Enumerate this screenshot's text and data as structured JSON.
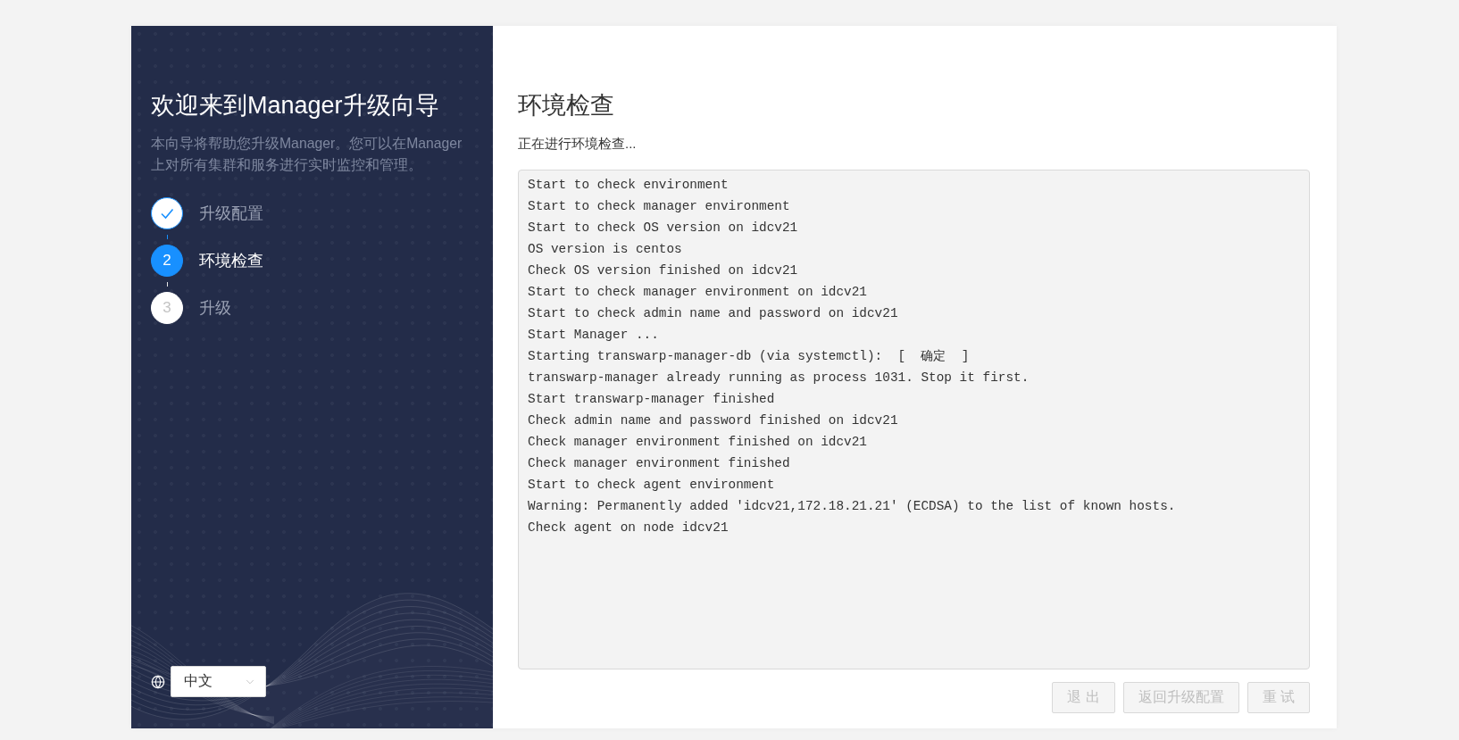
{
  "sidebar": {
    "title": "欢迎来到Manager升级向导",
    "description": "本向导将帮助您升级Manager。您可以在Manager上对所有集群和服务进行实时监控和管理。",
    "steps": [
      {
        "label": "升级配置",
        "completed": true,
        "selected": false
      },
      {
        "label": "环境检查",
        "completed": false,
        "selected": true,
        "number": "2"
      },
      {
        "label": "升级",
        "completed": false,
        "selected": false,
        "number": "3"
      }
    ],
    "language": {
      "value": "中文"
    }
  },
  "main": {
    "title": "环境检查",
    "subtitle": "正在进行环境检查...",
    "log_lines": [
      "Start to check environment",
      "Start to check manager environment",
      "Start to check OS version on idcv21",
      "OS version is centos",
      "Check OS version finished on idcv21",
      "Start to check manager environment on idcv21",
      "Start to check admin name and password on idcv21",
      "Start Manager ...",
      "Starting transwarp-manager-db (via systemctl):  [  确定  ]",
      "transwarp-manager already running as process 1031. Stop it first.",
      "Start transwarp-manager finished",
      "Check admin name and password finished on idcv21",
      "Check manager environment finished on idcv21",
      "Check manager environment finished",
      "Start to check agent environment",
      "Warning: Permanently added 'idcv21,172.18.21.21' (ECDSA) to the list of known hosts.",
      "Check agent on node idcv21"
    ],
    "buttons": [
      {
        "label": "退 出",
        "disabled": true
      },
      {
        "label": "返回升级配置",
        "disabled": true
      },
      {
        "label": "重 试",
        "disabled": true
      }
    ]
  }
}
